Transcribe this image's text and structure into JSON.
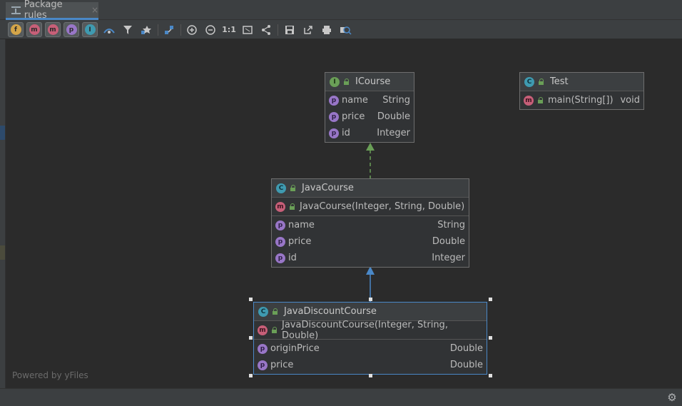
{
  "tab": {
    "title": "Package rules",
    "close_glyph": "×"
  },
  "toolbar": {
    "filters": [
      {
        "icon": "fields-filter-icon",
        "letter": "f",
        "color": "#d4a549"
      },
      {
        "icon": "constructors-filter-icon",
        "letter": "m",
        "color": "#c75f78"
      },
      {
        "icon": "methods-filter-icon",
        "letter": "m",
        "color": "#c75f78"
      },
      {
        "icon": "properties-filter-icon",
        "letter": "p",
        "color": "#9876c7"
      },
      {
        "icon": "inner-classes-filter-icon",
        "letter": "I",
        "color": "#3f9ab0"
      }
    ],
    "tools": [
      "change-visibility-icon",
      "filter-icon",
      "show-dependencies-icon",
      "layout-icon",
      "zoom-in-icon",
      "zoom-out-icon",
      "actual-size-icon",
      "fit-content-icon",
      "apply-layout-icon",
      "save-icon",
      "export-icon",
      "print-icon",
      "print-preview-icon"
    ],
    "actual_size_label": "1:1"
  },
  "diagram": {
    "nodes": [
      {
        "id": "icourse",
        "kind": "interface",
        "kind_letter": "I",
        "title": "ICourse",
        "constructors": [],
        "fields": [
          {
            "name": "name",
            "type": "String"
          },
          {
            "name": "price",
            "type": "Double"
          },
          {
            "name": "id",
            "type": "Integer"
          }
        ]
      },
      {
        "id": "test",
        "kind": "class",
        "kind_letter": "C",
        "title": "Test",
        "constructors": [],
        "methods": [
          {
            "name": "main(String[])",
            "type": "void"
          }
        ]
      },
      {
        "id": "javacourse",
        "kind": "class",
        "kind_letter": "C",
        "title": "JavaCourse",
        "constructors": [
          {
            "name": "JavaCourse(Integer, String, Double)"
          }
        ],
        "fields": [
          {
            "name": "name",
            "type": "String"
          },
          {
            "name": "price",
            "type": "Double"
          },
          {
            "name": "id",
            "type": "Integer"
          }
        ]
      },
      {
        "id": "javadiscountcourse",
        "kind": "class",
        "kind_letter": "C",
        "title": "JavaDiscountCourse",
        "selected": true,
        "constructors": [
          {
            "name": "JavaDiscountCourse(Integer, String, Double)"
          }
        ],
        "fields": [
          {
            "name": "originPrice",
            "type": "Double"
          },
          {
            "name": "price",
            "type": "Double"
          }
        ]
      }
    ],
    "edges": [
      {
        "from": "javacourse",
        "to": "icourse",
        "kind": "implements",
        "color": "#6a9f57"
      },
      {
        "from": "javadiscountcourse",
        "to": "javacourse",
        "kind": "extends",
        "color": "#4a88c7"
      }
    ],
    "member_letters": {
      "method": "m",
      "property": "p"
    }
  },
  "footer": {
    "powered_by": "Powered by yFiles"
  },
  "colors": {
    "selection": "#4a88c7",
    "implements": "#6a9f57",
    "extends": "#4a88c7"
  }
}
